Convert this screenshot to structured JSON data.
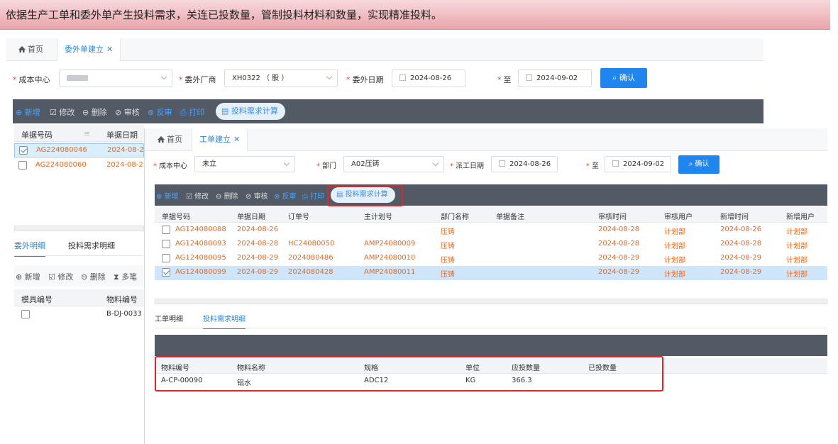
{
  "banner": {
    "text": "依据生产工单和委外单产生投料需求，关连已投数量，管制投料材料和数量，实现精准投料。"
  },
  "bg": {
    "tabs": [
      {
        "label": "首页"
      },
      {
        "label": "委外单建立"
      }
    ],
    "filters": {
      "cost_center_label": "成本中心",
      "cost_center_value": "",
      "vendor_label": "委外厂商",
      "vendor_value": "XH0322 （ 股 ）",
      "date_label": "委外日期",
      "date_from": "2024-08-26",
      "to_label": "至",
      "date_to": "2024-09-02",
      "confirm": "确认"
    },
    "toolbar": {
      "add": "新增",
      "edit": "修改",
      "delete": "删除",
      "audit": "审核",
      "unaudit": "反审",
      "print": "打印",
      "calc": "投料需求计算"
    },
    "grid": {
      "col1": "单据号码",
      "col2": "单据日期",
      "rows": [
        {
          "no": "AG224080046",
          "date": "2024-08-2",
          "checked": true
        },
        {
          "no": "AG224080060",
          "date": "2024-08-2",
          "checked": false
        }
      ]
    },
    "subtabs": {
      "tab1": "委外明细",
      "tab2": "投料需求明细"
    },
    "detail_toolbar": {
      "add": "新增",
      "edit": "修改",
      "delete": "删除",
      "multi": "多笔"
    },
    "detail_grid": {
      "col1": "模具编号",
      "col2": "物料编号",
      "row1_material": "B-DJ-0033"
    }
  },
  "fg": {
    "tabs": [
      {
        "label": "首页"
      },
      {
        "label": "工单建立"
      }
    ],
    "filters": {
      "cost_center_label": "成本中心",
      "cost_center_value": "未立",
      "dept_label": "部门",
      "dept_value": "A02压铸",
      "date_label": "派工日期",
      "date_from": "2024-08-26",
      "to_label": "至",
      "date_to": "2024-09-02",
      "confirm": "确认"
    },
    "toolbar": {
      "add": "新增",
      "edit": "修改",
      "delete": "删除",
      "audit": "审核",
      "unaudit": "反审",
      "print": "打印",
      "calc": "投料需求计算"
    },
    "grid": {
      "headers": [
        "单据号码",
        "单据日期",
        "订单号",
        "主计划号",
        "部门名称",
        "单据备注",
        "审核时间",
        "审核用户",
        "新增时间",
        "新增用户"
      ],
      "rows": [
        {
          "no": "AG124080088",
          "date": "2024-08-26",
          "order": "",
          "plan": "",
          "dept": "压铸",
          "note": "",
          "audit_time": "2024-08-28",
          "audit_user": "计划部",
          "add_time": "2024-08-26",
          "add_user": "计划部",
          "checked": false
        },
        {
          "no": "AG124080093",
          "date": "2024-08-28",
          "order": "HC24080050",
          "plan": "AMP24080009",
          "dept": "压铸",
          "note": "",
          "audit_time": "2024-08-28",
          "audit_user": "计划部",
          "add_time": "2024-08-28",
          "add_user": "计划部",
          "checked": false
        },
        {
          "no": "AG124080095",
          "date": "2024-08-29",
          "order": "2024080486",
          "plan": "AMP24080010",
          "dept": "压铸",
          "note": "",
          "audit_time": "2024-08-29",
          "audit_user": "计划部",
          "add_time": "2024-08-29",
          "add_user": "计划部",
          "checked": false
        },
        {
          "no": "AG124080099",
          "date": "2024-08-29",
          "order": "2024080428",
          "plan": "AMP24080011",
          "dept": "压铸",
          "note": "",
          "audit_time": "2024-08-29",
          "audit_user": "计划部",
          "add_time": "2024-08-29",
          "add_user": "计划部",
          "checked": true
        }
      ]
    },
    "subtabs": {
      "tab1": "工单明细",
      "tab2": "投料需求明细"
    },
    "material": {
      "headers": [
        "物料编号",
        "物料名称",
        "规格",
        "单位",
        "应投数量",
        "已投数量"
      ],
      "rows": [
        {
          "code": "A-CP-00090",
          "name": "铝水",
          "spec": "ADC12",
          "unit": "KG",
          "qty": "366.3",
          "fed": ""
        }
      ]
    }
  },
  "colors": {
    "accent": "#2f86d6",
    "orange": "#e66a1f",
    "highlight": "#e3252a",
    "toolbar": "#525a66"
  }
}
